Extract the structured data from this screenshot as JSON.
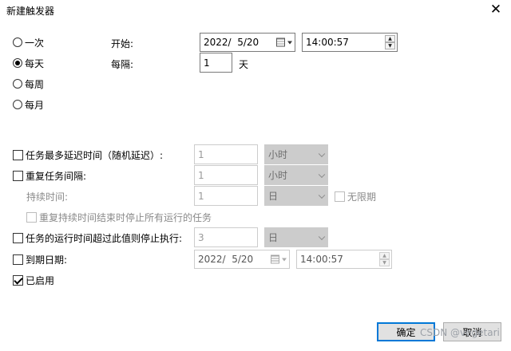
{
  "window": {
    "title": "新建触发器",
    "close_glyph": "✕"
  },
  "schedule": {
    "options": [
      {
        "label": "一次",
        "checked": false
      },
      {
        "label": "每天",
        "checked": true
      },
      {
        "label": "每周",
        "checked": false
      },
      {
        "label": "每月",
        "checked": false
      }
    ],
    "start_label": "开始:",
    "start_date": "2022/  5/20",
    "start_time": "14:00:57",
    "recur_label": "每隔:",
    "recur_value": "1",
    "recur_unit": "天"
  },
  "advanced": {
    "delay": {
      "label": "任务最多延迟时间（随机延迟）:",
      "checked": false,
      "value": "1",
      "unit": "小时"
    },
    "repeat": {
      "label": "重复任务间隔:",
      "checked": false,
      "value": "1",
      "unit": "小时"
    },
    "duration": {
      "label": "持续时间:",
      "value": "1",
      "unit": "日",
      "indefinite_label": "无限期",
      "indefinite_checked": false
    },
    "stop_repeat": {
      "label": "重复持续时间结束时停止所有运行的任务",
      "checked": false
    },
    "stop_long": {
      "label": "任务的运行时间超过此值则停止执行:",
      "checked": false,
      "value": "3",
      "unit": "日"
    },
    "expire": {
      "label": "到期日期:",
      "checked": false,
      "date": "2022/  5/20",
      "time": "14:00:57"
    },
    "enabled": {
      "label": "已启用",
      "checked": true
    }
  },
  "buttons": {
    "ok": "确定",
    "cancel": "取消"
  },
  "watermark": "CSDN @vegetari",
  "icons": {
    "spin_up": "▲",
    "spin_down": "▼"
  }
}
